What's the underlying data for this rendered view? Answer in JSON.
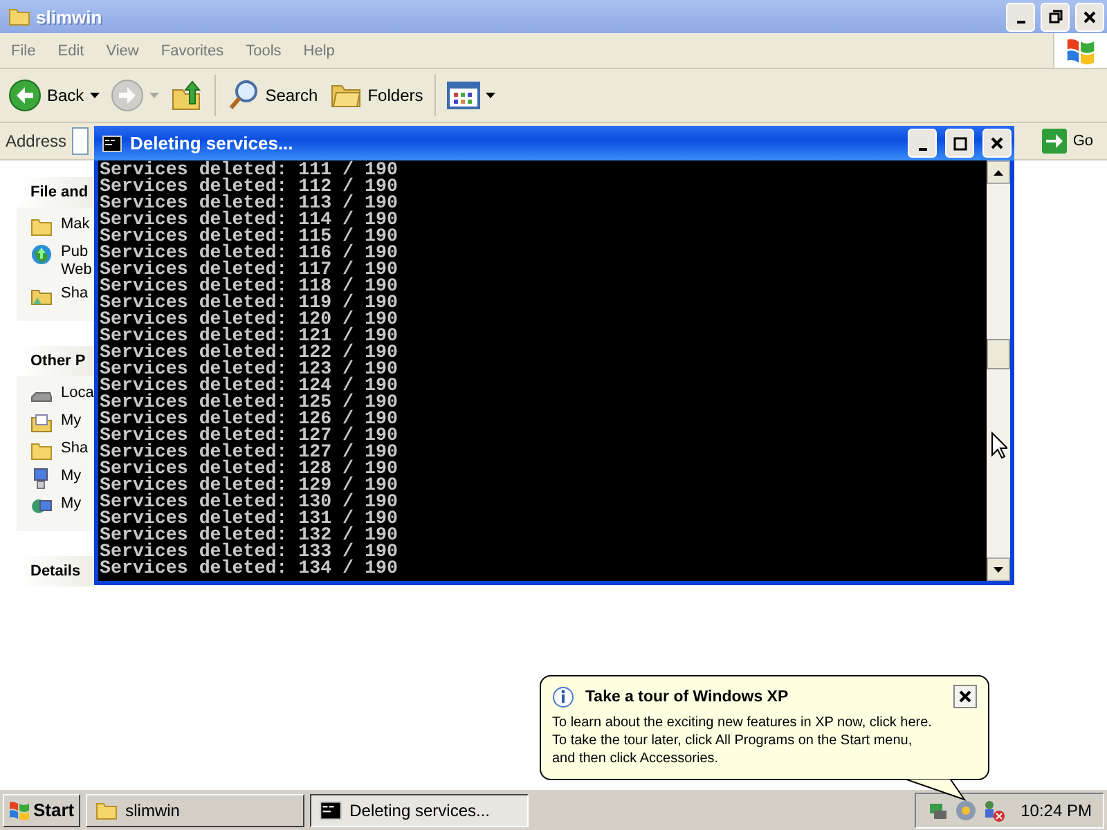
{
  "explorer": {
    "title": "slimwin",
    "menu": [
      "File",
      "Edit",
      "View",
      "Favorites",
      "Tools",
      "Help"
    ],
    "toolbar": [
      {
        "kind": "back",
        "label": "Back",
        "disabled": false
      },
      {
        "kind": "forward",
        "disabled": true
      },
      {
        "kind": "up",
        "disabled": false
      },
      {
        "kind": "search",
        "label": "Search",
        "disabled": false
      },
      {
        "kind": "folders",
        "label": "Folders",
        "disabled": false
      },
      {
        "kind": "views",
        "disabled": false
      }
    ],
    "address": {
      "label": "Address",
      "go": "Go"
    },
    "task_pane": [
      {
        "title": "File and",
        "items": [
          {
            "kind": "folder",
            "lines": [
              "Mak"
            ]
          },
          {
            "kind": "globe",
            "lines": [
              "Pub",
              "Web"
            ]
          },
          {
            "kind": "shared",
            "lines": [
              "Sha"
            ]
          }
        ]
      },
      {
        "title": "Other P",
        "items": [
          {
            "kind": "drive",
            "lines": [
              "Loca"
            ]
          },
          {
            "kind": "docs",
            "lines": [
              "My"
            ]
          },
          {
            "kind": "folder",
            "lines": [
              "Sha"
            ]
          },
          {
            "kind": "computer",
            "lines": [
              "My"
            ]
          },
          {
            "kind": "network",
            "lines": [
              "My"
            ]
          }
        ]
      },
      {
        "title": "Details"
      }
    ]
  },
  "console": {
    "title": "Deleting services...",
    "lines": [
      "Services deleted: 111 / 190",
      "Services deleted: 112 / 190",
      "Services deleted: 113 / 190",
      "Services deleted: 114 / 190",
      "Services deleted: 115 / 190",
      "Services deleted: 116 / 190",
      "Services deleted: 117 / 190",
      "Services deleted: 118 / 190",
      "Services deleted: 119 / 190",
      "Services deleted: 120 / 190",
      "Services deleted: 121 / 190",
      "Services deleted: 122 / 190",
      "Services deleted: 123 / 190",
      "Services deleted: 124 / 190",
      "Services deleted: 125 / 190",
      "Services deleted: 126 / 190",
      "Services deleted: 127 / 190",
      "Services deleted: 127 / 190",
      "Services deleted: 128 / 190",
      "Services deleted: 129 / 190",
      "Services deleted: 130 / 190",
      "Services deleted: 131 / 190",
      "Services deleted: 132 / 190",
      "Services deleted: 133 / 190",
      "Services deleted: 134 / 190"
    ]
  },
  "balloon": {
    "title": "Take a tour of Windows XP",
    "lines": [
      "To learn about the exciting new features in XP now, click here.",
      "To take the tour later, click All Programs on the Start menu,",
      "and then click Accessories."
    ]
  },
  "taskbar": {
    "start": "Start",
    "buttons": [
      {
        "kind": "folder",
        "label": "slimwin",
        "selected": false
      },
      {
        "kind": "console",
        "label": "Deleting services...",
        "selected": true
      }
    ],
    "clock": "10:24 PM"
  }
}
